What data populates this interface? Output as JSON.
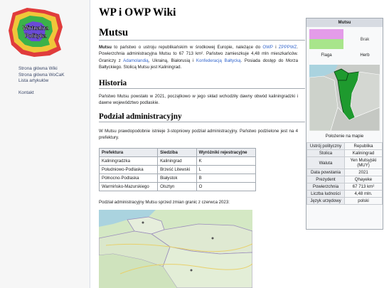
{
  "site": {
    "logo_text": "Wirtualna Polityka",
    "title": "WP i OWP Wiki"
  },
  "nav": {
    "items": [
      "Strona główna Wiki",
      "Strona główna WoCaK",
      "Lista artykułów"
    ],
    "contact": "Kontakt"
  },
  "article": {
    "title": "Mutsu",
    "intro": {
      "bold": "Mutsu",
      "t1": " to państwo o ustroju republikańskim w środkowej Europie, należące do ",
      "link1": "OWP",
      "t2": " i ",
      "link2": "ZPPPWZ",
      "t3": ". Powierzchnia administracyjna Mutsu to 67 713 km². Państwo zamieszkuje 4,48 mln mieszkańców. Graniczy z ",
      "link3": "Adamolandią",
      "t4": ", Ukrainą, Białorusią i ",
      "link4": "Konfederacją Bałtycką",
      "t5": ". Posiada dostęp do Morza Bałtyckiego. Stolicą Mutsu jest Kaliningrad."
    },
    "history_heading": "Historia",
    "history_text": "Państwo Mutsu powstało w 2021, początkowo w jego skład wchodziły dawny obwód kaliningradzki i dawne województwo podlaskie.",
    "admin_heading": "Podział administracyjny",
    "admin_text": "W Mutsu prawdopodobnie istnieje 3-stopniowy podział administracyjny. Państwo podzielone jest na 4 prefektury.",
    "table": {
      "headers": [
        "Prefektura",
        "Siedziba",
        "Wyróżniki rejestracyjne"
      ],
      "rows": [
        [
          "Kaliningradzka",
          "Kaliningrad",
          "K"
        ],
        [
          "Południowo-Podlaska",
          "Brześć Litewski",
          "L"
        ],
        [
          "Północno-Podlaska",
          "Białystok",
          "B"
        ],
        [
          "Warmińsko-Mazurskiego",
          "Olsztyn",
          "O"
        ]
      ]
    },
    "map_caption": "Podział administracyjny Mutsu sprzed zmian granic z czerwca 2023:"
  },
  "infobox": {
    "title": "Mutsu",
    "coat_placeholder": "Brak",
    "flag_caption": "Flaga",
    "coat_caption": "Herb",
    "location_caption": "Położenie na mapie",
    "flag_colors": {
      "top": "#e49ce9",
      "bottom": "#a8e58b"
    },
    "rows": [
      [
        "Ustrój polityczny",
        "Republika"
      ],
      [
        "Stolica",
        "Kaliningrad"
      ],
      [
        "Waluta",
        "Yen Mutsyjski (MUY)"
      ],
      [
        "Data powstania",
        "2021"
      ],
      [
        "Prezydent",
        "Qhayeke"
      ],
      [
        "Powierzchnia",
        "67 713 km²"
      ],
      [
        "Liczba ludności",
        "4,48 mln."
      ],
      [
        "Język urzędowy",
        "polski"
      ]
    ]
  }
}
